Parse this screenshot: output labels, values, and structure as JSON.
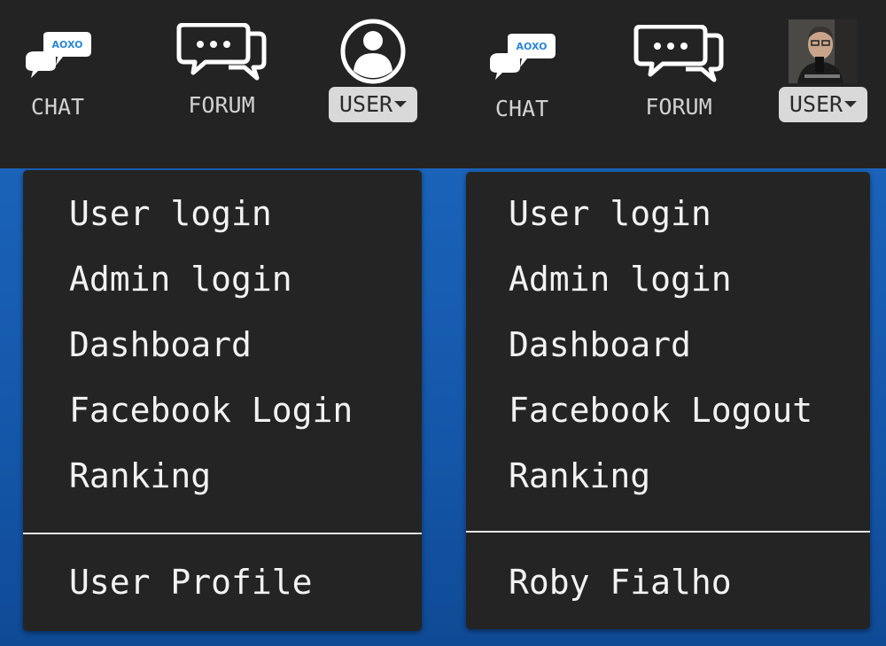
{
  "left": {
    "nav": {
      "chat_label": "CHAT",
      "chat_logo_text": "AOXO",
      "forum_label": "FORUM",
      "user_label": "USER"
    },
    "menu": {
      "items": [
        "User login",
        "Admin login",
        "Dashboard",
        "Facebook Login",
        "Ranking"
      ],
      "footer": "User Profile"
    }
  },
  "right": {
    "nav": {
      "chat_label": "CHAT",
      "chat_logo_text": "AOXO",
      "forum_label": "FORUM",
      "user_label": "USER"
    },
    "menu": {
      "items": [
        "User login",
        "Admin login",
        "Dashboard",
        "Facebook Logout",
        "Ranking"
      ],
      "footer": "Roby Fialho"
    }
  },
  "icons": {
    "chat": "chat-bubbles-icon",
    "forum": "forum-speech-bubbles-icon",
    "user": "user-circle-icon",
    "caret": "caret-down-icon",
    "avatar": "user-avatar-photo"
  },
  "colors": {
    "navbar": "#232323",
    "menu_bg": "#242424",
    "page_bg": "#1a63b9",
    "user_button": "#d9d9d9",
    "chat_bubble": "#ffffff",
    "chat_logo": "#2b86d6"
  }
}
